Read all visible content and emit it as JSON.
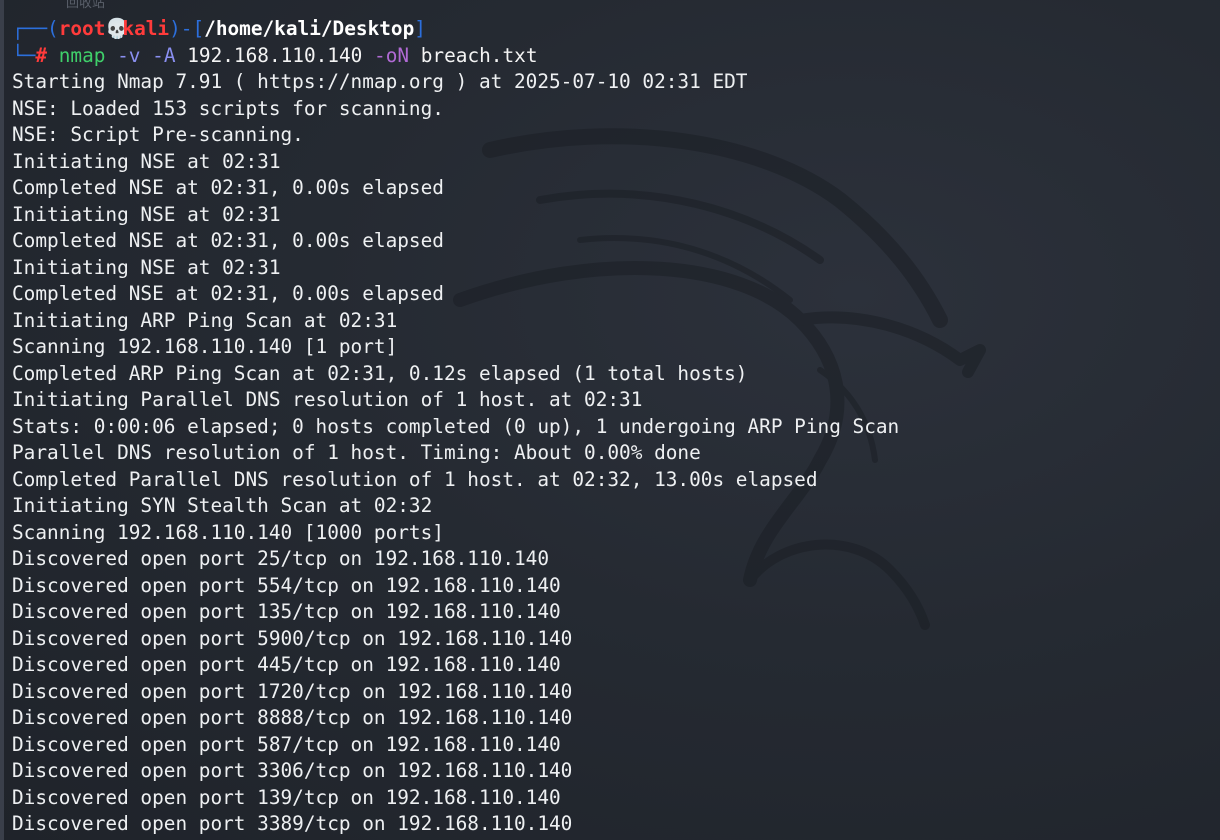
{
  "window": {
    "ghost_title": "回收站"
  },
  "prompt": {
    "user": "root",
    "skull": "💀",
    "host": "kali",
    "path": "/home/kali/Desktop",
    "symbol": "#"
  },
  "command": {
    "program": "nmap",
    "flag_v": "-v",
    "flag_a": "-A",
    "target": "192.168.110.140",
    "flag_on": "-oN",
    "outfile": "breach.txt"
  },
  "output": [
    "Starting Nmap 7.91 ( https://nmap.org ) at 2025-07-10 02:31 EDT",
    "NSE: Loaded 153 scripts for scanning.",
    "NSE: Script Pre-scanning.",
    "Initiating NSE at 02:31",
    "Completed NSE at 02:31, 0.00s elapsed",
    "Initiating NSE at 02:31",
    "Completed NSE at 02:31, 0.00s elapsed",
    "Initiating NSE at 02:31",
    "Completed NSE at 02:31, 0.00s elapsed",
    "Initiating ARP Ping Scan at 02:31",
    "Scanning 192.168.110.140 [1 port]",
    "Completed ARP Ping Scan at 02:31, 0.12s elapsed (1 total hosts)",
    "Initiating Parallel DNS resolution of 1 host. at 02:31",
    "Stats: 0:00:06 elapsed; 0 hosts completed (0 up), 1 undergoing ARP Ping Scan",
    "Parallel DNS resolution of 1 host. Timing: About 0.00% done",
    "Completed Parallel DNS resolution of 1 host. at 02:32, 13.00s elapsed",
    "Initiating SYN Stealth Scan at 02:32",
    "Scanning 192.168.110.140 [1000 ports]",
    "Discovered open port 25/tcp on 192.168.110.140",
    "Discovered open port 554/tcp on 192.168.110.140",
    "Discovered open port 135/tcp on 192.168.110.140",
    "Discovered open port 5900/tcp on 192.168.110.140",
    "Discovered open port 445/tcp on 192.168.110.140",
    "Discovered open port 1720/tcp on 192.168.110.140",
    "Discovered open port 8888/tcp on 192.168.110.140",
    "Discovered open port 587/tcp on 192.168.110.140",
    "Discovered open port 3306/tcp on 192.168.110.140",
    "Discovered open port 139/tcp on 192.168.110.140",
    "Discovered open port 3389/tcp on 192.168.110.140"
  ],
  "colors": {
    "background": "#23252e",
    "text": "#eef0f2",
    "prompt_red": "#ff3b3b",
    "prompt_blue": "#2c6fdc",
    "command_green": "#3fd06a",
    "flag_purple": "#8a8ff0"
  },
  "icons": {
    "skull": "skull-icon",
    "watermark": "kali-dragon-logo"
  }
}
